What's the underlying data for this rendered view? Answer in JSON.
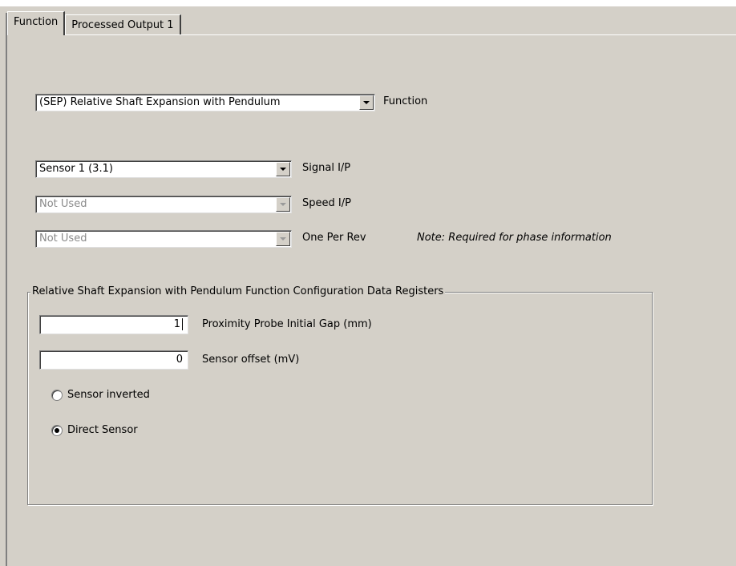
{
  "tabs": [
    {
      "label": "Function",
      "active": true
    },
    {
      "label": "Processed Output 1",
      "active": false
    }
  ],
  "function_select": {
    "value": "(SEP) Relative Shaft Expansion with Pendulum",
    "label": "Function"
  },
  "signal_select": {
    "value": "Sensor 1 (3.1)",
    "label": "Signal I/P"
  },
  "speed_select": {
    "value": "Not Used",
    "label": "Speed I/P",
    "disabled": true
  },
  "once_per_rev_select": {
    "value": "Not Used",
    "label": "One Per Rev",
    "disabled": true,
    "note": "Note: Required for phase information"
  },
  "config_group": {
    "title": "Relative Shaft Expansion with Pendulum Function Configuration Data Registers",
    "gap_field": {
      "value": "1",
      "label": "Proximity Probe Initial Gap (mm)"
    },
    "offset_field": {
      "value": "0",
      "label": "Sensor offset (mV)"
    },
    "radio_inverted": {
      "label": "Sensor inverted",
      "checked": false
    },
    "radio_direct": {
      "label": "Direct Sensor",
      "checked": true
    }
  }
}
